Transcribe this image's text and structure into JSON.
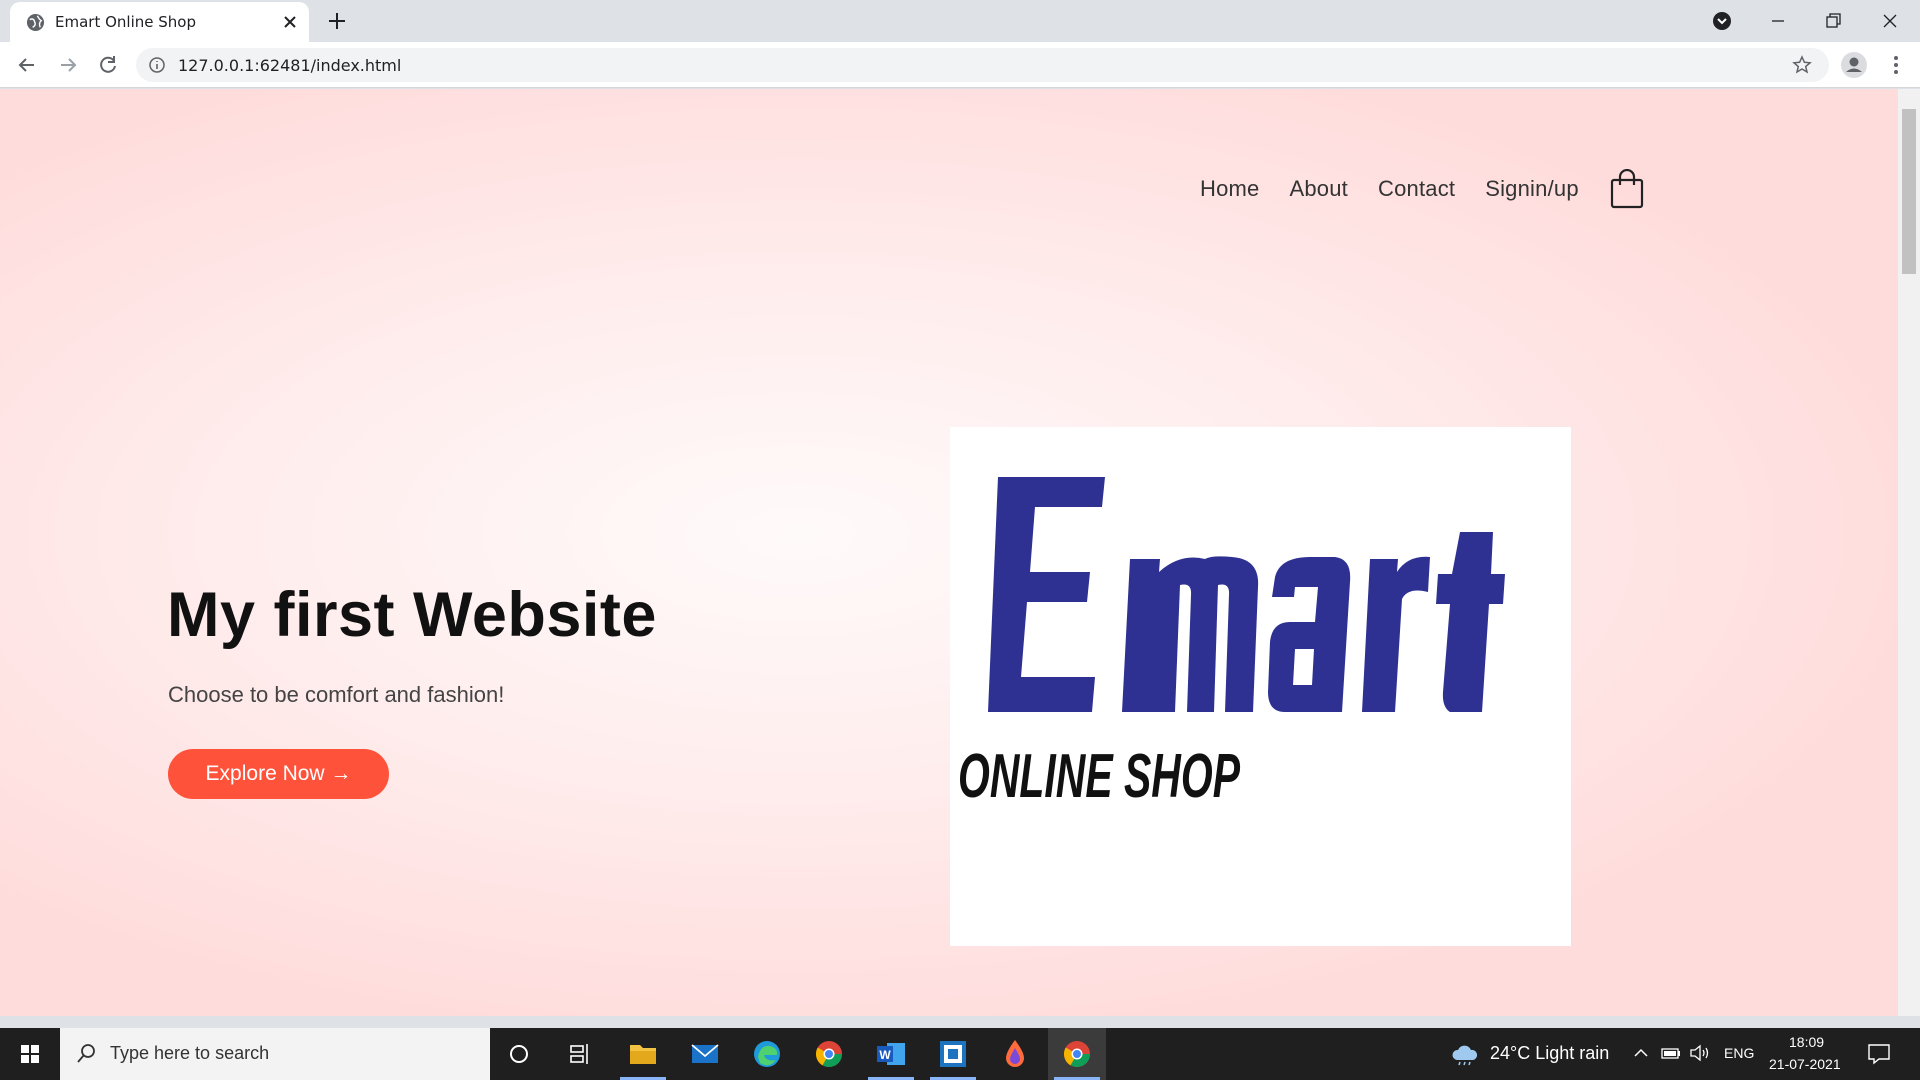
{
  "browser": {
    "tab_title": "Emart Online Shop",
    "url": "127.0.0.1:62481/index.html"
  },
  "site": {
    "nav": [
      "Home",
      "About",
      "Contact",
      "Signin/up"
    ],
    "hero_title": "My first Website",
    "hero_subtitle": "Choose to be comfort and fashion!",
    "cta_label": "Explore Now →",
    "cta_color": "#ff523b",
    "logo": {
      "word": "Emart",
      "tagline": "ONLINE SHOP",
      "word_color": "#2e3192"
    }
  },
  "taskbar": {
    "search_placeholder": "Type here to search",
    "weather": "24°C  Light rain",
    "language": "ENG",
    "time": "18:09",
    "date": "21-07-2021",
    "apps": [
      "cortana-icon",
      "task-view-icon",
      "file-explorer-icon",
      "mail-icon",
      "edge-icon",
      "chrome-icon",
      "word-icon",
      "app-icon",
      "paint-icon",
      "chrome-active-icon"
    ]
  }
}
